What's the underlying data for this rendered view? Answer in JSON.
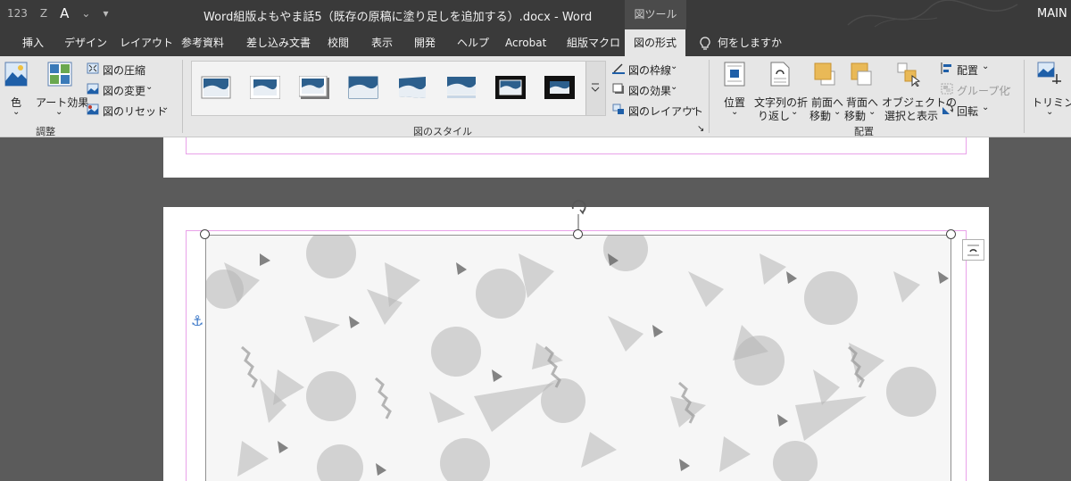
{
  "titlebar": {
    "doc_title": "Word組版よもやま話5（既存の原稿に塗り足しを追加する）.docx  -  Word",
    "tool_context": "図ツール",
    "account": "MAIN U",
    "qat": [
      "123",
      "Z",
      "A",
      "⌄",
      "▾"
    ]
  },
  "tabs": [
    "挿入",
    "デザイン",
    "レイアウト",
    "参考資料",
    "差し込み文書",
    "校閲",
    "表示",
    "開発",
    "ヘルプ",
    "Acrobat",
    "組版マクロ",
    "図の形式"
  ],
  "active_tab": "図の形式",
  "tell_me": "何をしますか",
  "ribbon": {
    "adjust": {
      "color": "色",
      "art_effects": "アート効果",
      "compress": "図の圧縮",
      "change": "図の変更",
      "reset": "図のリセット",
      "group_label": "調整"
    },
    "styles": {
      "border": "図の枠線",
      "effects": "図の効果",
      "layout": "図のレイアウト",
      "group_label": "図のスタイル"
    },
    "arrange": {
      "position": "位置",
      "wrap_text_1": "文字列の折",
      "wrap_text_2": "り返し",
      "bring_forward_1": "前面へ",
      "bring_forward_2": "移動",
      "send_backward_1": "背面へ",
      "send_backward_2": "移動",
      "selection_pane_1": "オブジェクトの",
      "selection_pane_2": "選択と表示",
      "align": "配置",
      "group": "グループ化",
      "rotate": "回転",
      "group_label": "配置"
    },
    "size": {
      "crop": "トリミング"
    }
  },
  "colors": {
    "titlebar": "#3a3a3a",
    "ribbon": "#e6e6e6",
    "workspace": "#5b5b5b",
    "margin_guide": "#e9a2e9"
  }
}
